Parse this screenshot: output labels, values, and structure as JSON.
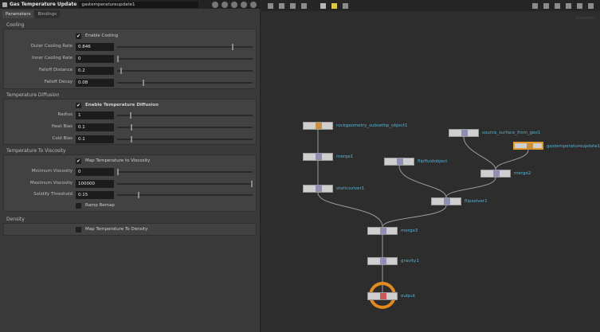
{
  "header": {
    "node_type": "Gas Temperature Update",
    "node_name": "gastemperatureupdate1",
    "tabs": [
      "Parameters",
      "Bindings"
    ]
  },
  "folders": {
    "cooling": {
      "title": "Cooling",
      "enable_label": "Enable Cooling",
      "params": [
        {
          "label": "Outer Cooling Rate",
          "value": "0.846"
        },
        {
          "label": "Inner Cooling Rate",
          "value": "0"
        },
        {
          "label": "Falloff Distance",
          "value": "0.2"
        },
        {
          "label": "Falloff Decay",
          "value": "0.08"
        }
      ]
    },
    "diffusion": {
      "title": "Temperature Diffusion",
      "enable_label": "Enable Temperature Diffusion",
      "params": [
        {
          "label": "Radius",
          "value": "1"
        },
        {
          "label": "Heat Bias",
          "value": "0.1"
        },
        {
          "label": "Cold Bias",
          "value": "0.1"
        }
      ]
    },
    "viscosity": {
      "title": "Temperature To Viscosity",
      "enable_label": "Map Temperature to Viscosity",
      "params": [
        {
          "label": "Minimum Viscosity",
          "value": "0"
        },
        {
          "label": "Maximum Viscosity",
          "value": "100000"
        },
        {
          "label": "Solidify Threshold",
          "value": "0.15"
        }
      ],
      "ramp_label": "Ramp Remap"
    },
    "density": {
      "title": "Density",
      "map_label": "Map Temperature To Density"
    }
  },
  "network": {
    "nodes": {
      "sub_object": "rockgeometry_subsethp_object1",
      "merge1": "merge1",
      "staticsolver": "staticsolver1",
      "flipfluid": "flipfluidobject",
      "source_surface": "source_surface_from_geo1",
      "gastemp": "gastemperatureupdate1",
      "merge2": "merge2",
      "flipsolver": "flipsolver1",
      "merge3": "merge3",
      "gravity": "gravity1",
      "output": "output"
    },
    "watermark": "Dynamics"
  },
  "colors": {
    "selected_node": "#e39a2c",
    "output_ring": "#e08a1f",
    "node_label": "#58b2d6"
  }
}
